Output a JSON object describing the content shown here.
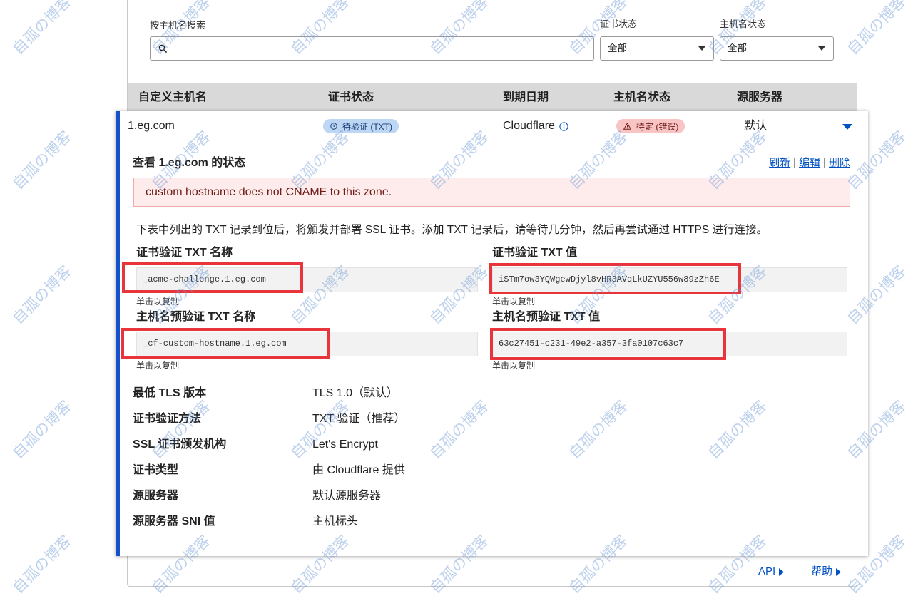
{
  "watermark": "自孤の博客",
  "filters": {
    "search_label": "按主机名搜索",
    "cert_status_label": "证书状态",
    "cert_status_value": "全部",
    "hostname_status_label": "主机名状态",
    "hostname_status_value": "全部"
  },
  "table": {
    "headers": [
      "自定义主机名",
      "证书状态",
      "到期日期",
      "主机名状态",
      "源服务器"
    ]
  },
  "row": {
    "hostname": "1.eg.com",
    "cert_status": "待验证 (TXT)",
    "expiry": "Cloudflare",
    "hostname_status": "待定 (错误)",
    "origin": "默认"
  },
  "details": {
    "title": "查看 1.eg.com 的状态",
    "actions": {
      "refresh": "刷新",
      "edit": "编辑",
      "delete": "删除",
      "separator": "|"
    },
    "error": "custom hostname does not CNAME to this zone.",
    "instructions": "下表中列出的 TXT 记录到位后，将颁发并部署 SSL 证书。添加 TXT 记录后，请等待几分钟，然后再尝试通过 HTTPS 进行连接。",
    "records": [
      {
        "label": "证书验证 TXT 名称",
        "value": "_acme-challenge.1.eg.com",
        "hint": "单击以复制"
      },
      {
        "label": "证书验证 TXT 值",
        "value": "iSTm7ow3YQWgewDjyl8vHR3AVqLkUZYU556w89zZh6E",
        "hint": "单击以复制"
      },
      {
        "label": "主机名预验证 TXT 名称",
        "value": "_cf-custom-hostname.1.eg.com",
        "hint": "单击以复制"
      },
      {
        "label": "主机名预验证 TXT 值",
        "value": "63c27451-c231-49e2-a357-3fa0107c63c7",
        "hint": "单击以复制"
      }
    ],
    "properties": [
      {
        "label": "最低 TLS 版本",
        "value": "TLS 1.0（默认）"
      },
      {
        "label": "证书验证方法",
        "value": "TXT 验证（推荐）"
      },
      {
        "label": "SSL 证书颁发机构",
        "value": "Let's Encrypt"
      },
      {
        "label": "证书类型",
        "value": "由 Cloudflare 提供"
      },
      {
        "label": "源服务器",
        "value": "默认源服务器"
      },
      {
        "label": "源服务器 SNI 值",
        "value": "主机标头"
      }
    ]
  },
  "footer": {
    "api": "API",
    "help": "帮助"
  },
  "icons": {
    "search": "search-icon",
    "select_caret": "caret-down-icon",
    "cert_status": "clock-icon",
    "expiry_info": "info-icon",
    "hostname_status": "warning-icon",
    "row_toggle": "caret-down-icon",
    "footer_link": "caret-right-icon"
  },
  "colors": {
    "accent": "#0051c3",
    "card_bar": "#1452cc",
    "header_bg": "#d9d9d9",
    "error_bg": "#fdeceb",
    "error_border": "#f2aaa6",
    "error_text": "#6f1b17",
    "highlight": "#e8353c",
    "badge_pending_bg": "#bcd6f4",
    "badge_pending_text": "#1d3f78",
    "badge_error_bg": "#f8c4c4",
    "badge_error_text": "#6f1b17",
    "watermark": "#6f9ad8"
  }
}
